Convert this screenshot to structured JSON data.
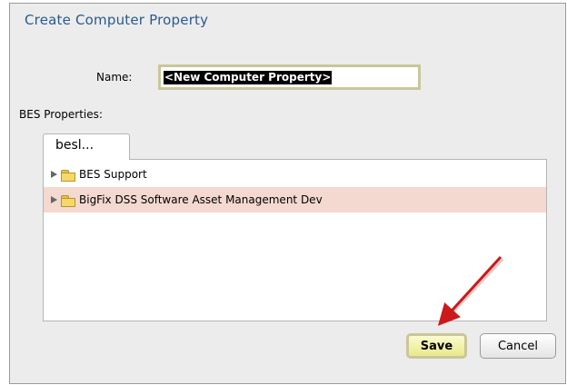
{
  "dialog": {
    "title": "Create Computer Property",
    "name_label": "Name:",
    "name_value": "<New Computer Property>",
    "bes_properties_label": "BES Properties:",
    "tab_label": "besl...",
    "tree_items": [
      {
        "label": "BES Support",
        "icon": "folder-icon",
        "selected": false
      },
      {
        "label": "BigFix DSS Software Asset Management Dev",
        "icon": "folder-icon",
        "selected": true
      }
    ],
    "save_label": "Save",
    "cancel_label": "Cancel"
  },
  "colors": {
    "title": "#2a5a8c",
    "selected_row": "#f3d9cf",
    "focus_border": "#c9c79a",
    "annotation_arrow": "#cc1a1a"
  }
}
